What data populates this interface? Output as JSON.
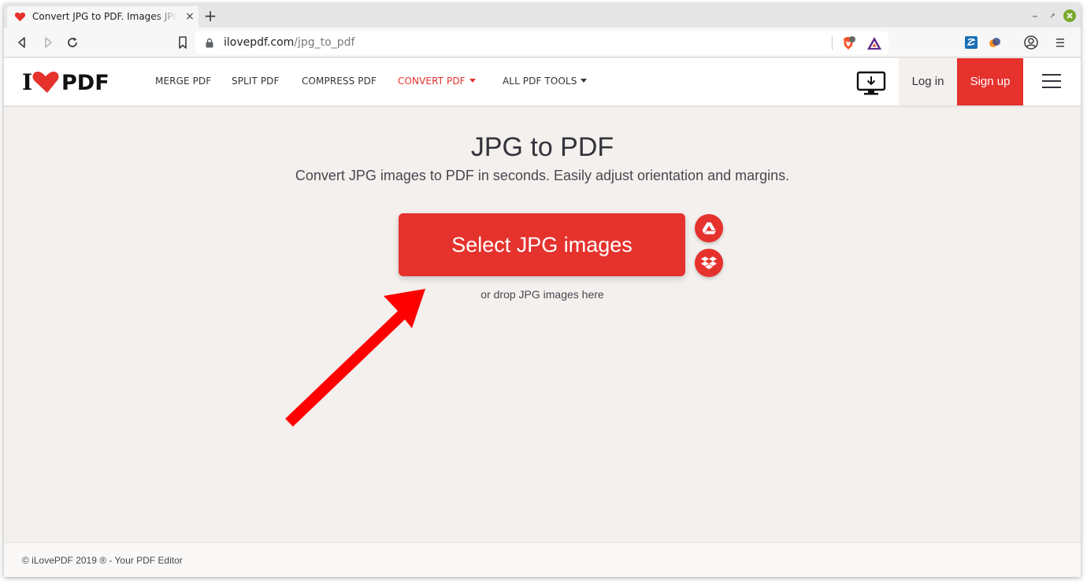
{
  "browser": {
    "tab_title": "Convert JPG to PDF. Images JPG to PDF",
    "tab_close": "×",
    "new_tab": "+",
    "url_host": "ilovepdf.com",
    "url_path": "/jpg_to_pdf"
  },
  "site": {
    "logo_i": "I",
    "logo_pdf": "PDF",
    "nav": {
      "merge": "MERGE PDF",
      "split": "SPLIT PDF",
      "compress": "COMPRESS PDF",
      "convert": "CONVERT PDF",
      "all_tools": "ALL PDF TOOLS"
    },
    "login": "Log in",
    "signup": "Sign up"
  },
  "hero": {
    "title": "JPG to PDF",
    "subtitle": "Convert JPG images to PDF in seconds. Easily adjust orientation and margins.",
    "select_button": "Select JPG images",
    "drop_text": "or drop JPG images here"
  },
  "footer": {
    "text": "© iLovePDF 2019 ® - Your PDF Editor"
  },
  "colors": {
    "brand_red": "#e5322d",
    "page_bg": "#f3f0ed",
    "text_dark": "#33333b"
  },
  "icons": [
    "heart-favicon-icon",
    "back-icon",
    "forward-icon",
    "reload-icon",
    "bookmark-icon",
    "lock-icon",
    "brave-shield-icon",
    "brave-rewards-icon",
    "extension-icon",
    "extension-2-icon",
    "profile-icon",
    "menu-icon",
    "desktop-download-icon",
    "google-drive-icon",
    "dropbox-icon",
    "hamburger-icon",
    "arrow-annotation-icon"
  ]
}
